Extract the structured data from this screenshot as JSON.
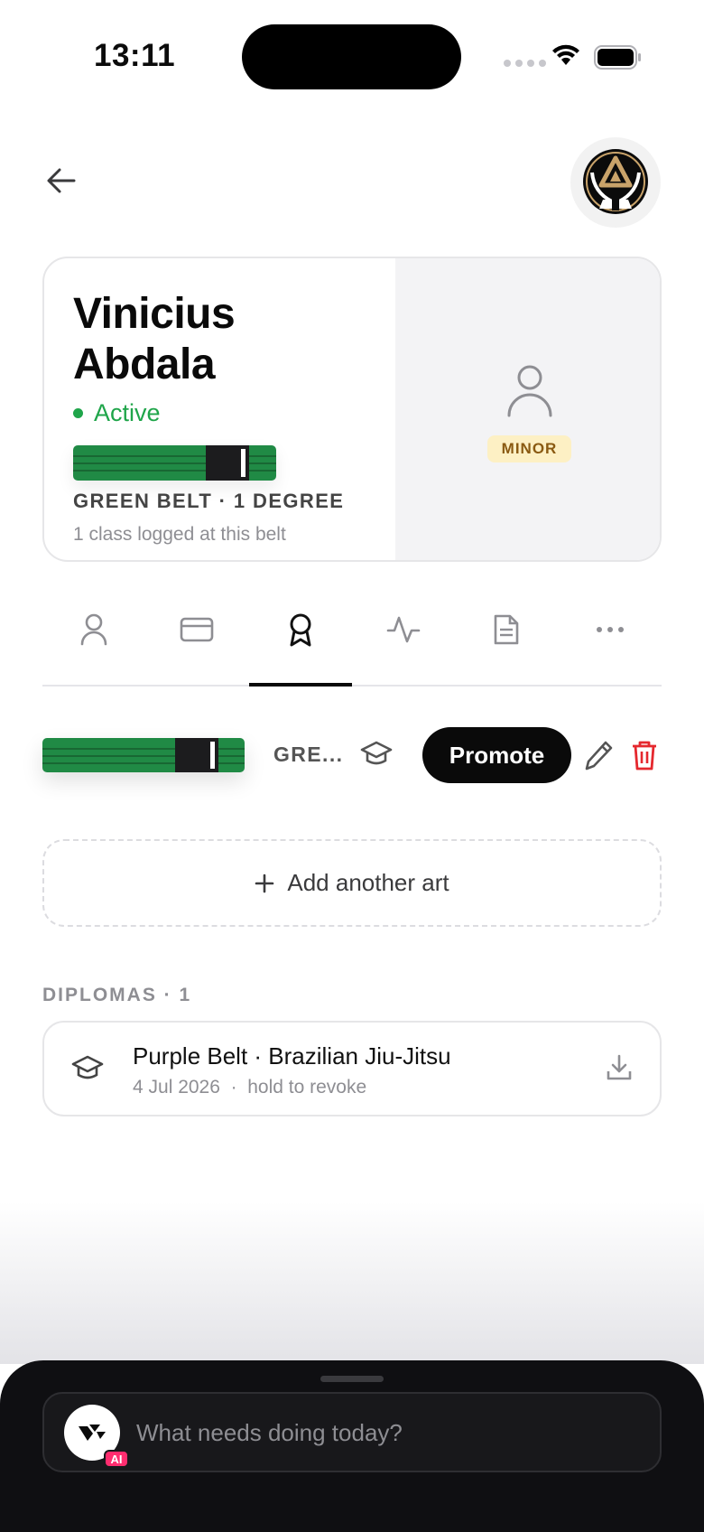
{
  "status_bar": {
    "time": "13:11"
  },
  "profile": {
    "first_name": "Vinicius",
    "last_name": "Abdala",
    "status": "Active",
    "belt_color": "#208a45",
    "rank": "GREEN BELT · 1 DEGREE",
    "classes_logged": "1 class logged at this belt",
    "age_badge": "MINOR"
  },
  "tabs": [
    {
      "icon": "person-icon",
      "active": false
    },
    {
      "icon": "card-icon",
      "active": false
    },
    {
      "icon": "award-icon",
      "active": true
    },
    {
      "icon": "activity-icon",
      "active": false
    },
    {
      "icon": "document-icon",
      "active": false
    },
    {
      "icon": "more-icon",
      "active": false
    }
  ],
  "art": {
    "label": "GRE...",
    "promote_label": "Promote"
  },
  "add_art_label": "Add another art",
  "diplomas": {
    "section_title": "DIPLOMAS · 1",
    "items": [
      {
        "title": "Purple Belt · Brazilian Jiu-Jitsu",
        "subtitle": "4 Jul 2026  ·  hold to revoke"
      }
    ]
  },
  "ai_bar": {
    "placeholder": "What needs doing today?",
    "badge": "AI"
  },
  "colors": {
    "active_green": "#1fa54a",
    "delete_red": "#e5282e",
    "minor_badge_bg": "#fdf0c4"
  }
}
